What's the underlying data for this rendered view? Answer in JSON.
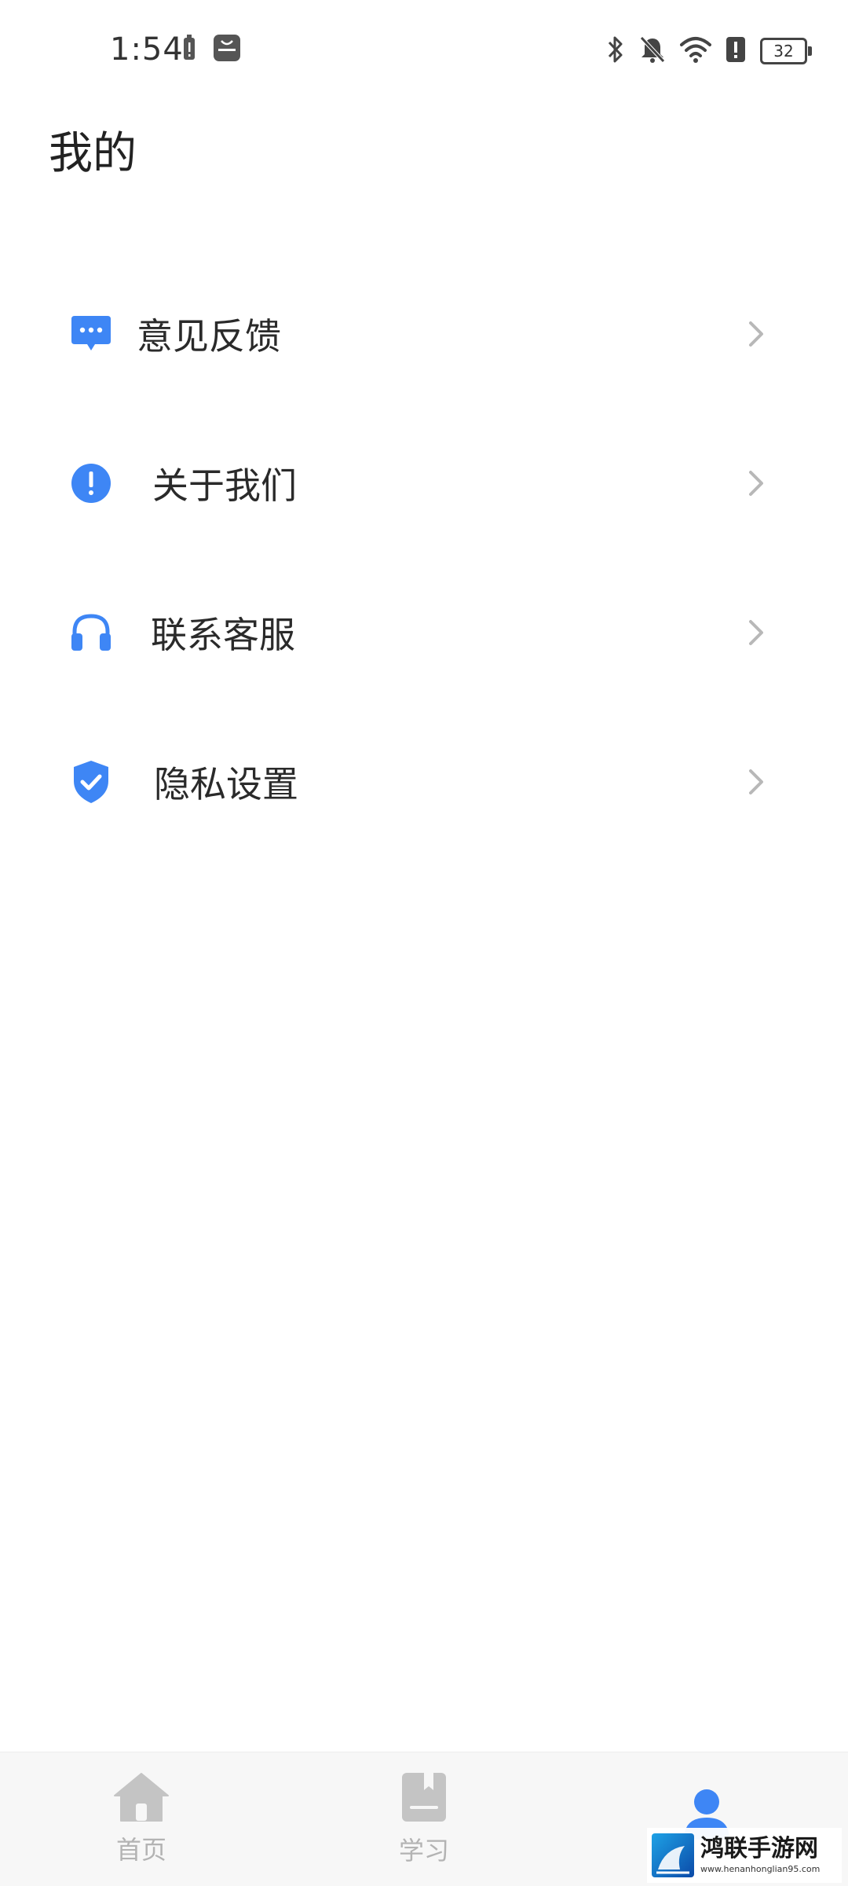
{
  "status_bar": {
    "time": "1:54",
    "battery_level": "32",
    "left_icons": [
      "battery-alert-icon",
      "huawei-app-icon"
    ],
    "right_icons": [
      "bluetooth-icon",
      "bell-off-icon",
      "wifi-icon",
      "alert-icon",
      "battery-icon"
    ]
  },
  "page": {
    "title": "我的"
  },
  "menu": {
    "items": [
      {
        "label": "意见反馈",
        "icon": "feedback-chat-icon"
      },
      {
        "label": "关于我们",
        "icon": "info-exclamation-icon"
      },
      {
        "label": "联系客服",
        "icon": "headphones-icon"
      },
      {
        "label": "隐私设置",
        "icon": "shield-check-icon"
      }
    ]
  },
  "bottom_nav": {
    "items": [
      {
        "label": "首页",
        "icon": "home-icon",
        "active": false
      },
      {
        "label": "学习",
        "icon": "book-icon",
        "active": false
      },
      {
        "label": "",
        "icon": "user-icon",
        "active": true
      }
    ]
  },
  "watermark": {
    "title": "鸿联手游网",
    "url": "www.henanhonglian95.com"
  },
  "colors": {
    "accent": "#3e86f5",
    "inactive": "#b3b3b3",
    "chevron": "#b8b8b8"
  }
}
